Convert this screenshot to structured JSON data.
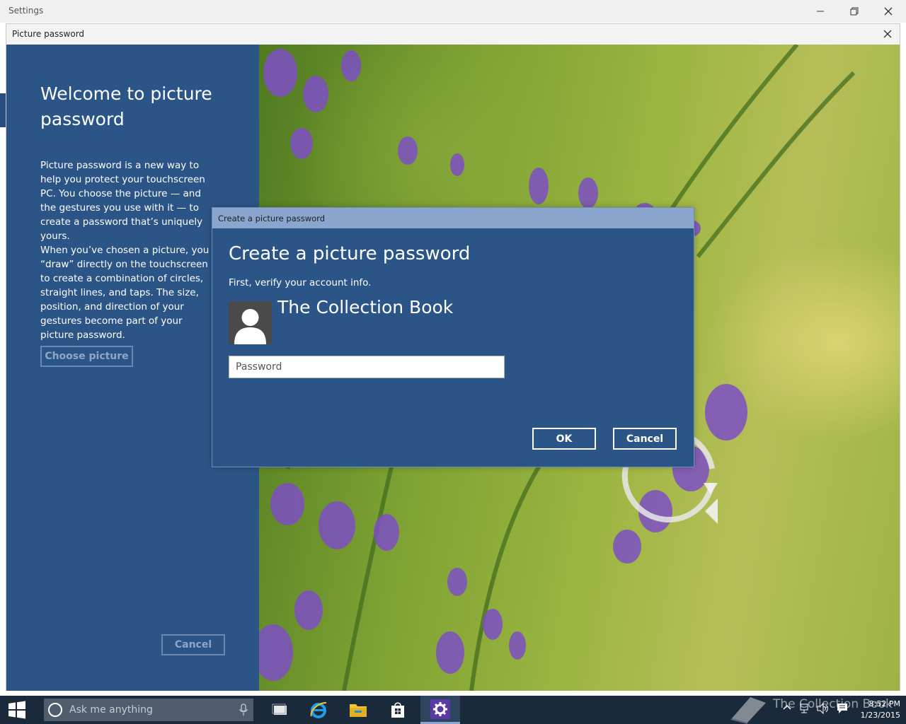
{
  "settings_window": {
    "title": "Settings",
    "controls": [
      "minimize",
      "restore",
      "close"
    ]
  },
  "picture_password_window": {
    "title": "Picture password",
    "heading": "Welcome to picture password",
    "paragraph1": "Picture password is a new way to help you protect your touchscreen PC. You choose the picture — and the gestures you use with it — to create a password that’s uniquely yours.",
    "paragraph2": "When you’ve chosen a picture, you “draw” directly on the touchscreen to create a combination of circles, straight lines, and taps. The size, position, and direction of your gestures become part of your picture password.",
    "choose_picture_label": "Choose picture",
    "cancel_label": "Cancel",
    "colors": {
      "panel": "#2c5587",
      "dialog_titlebar": "#8aa6cf"
    }
  },
  "dialog": {
    "title": "Create a picture password",
    "heading": "Create a picture password",
    "subtext": "First, verify your account info.",
    "account_name": "The Collection Book",
    "password_placeholder": "Password",
    "password_value": "",
    "ok_label": "OK",
    "cancel_label": "Cancel"
  },
  "taskbar": {
    "search_placeholder": "Ask me anything",
    "apps": [
      "task-view",
      "internet-explorer",
      "file-explorer",
      "store",
      "settings"
    ],
    "watermark": "The Collection Book",
    "time": "8:52 PM",
    "date": "1/23/2015"
  }
}
